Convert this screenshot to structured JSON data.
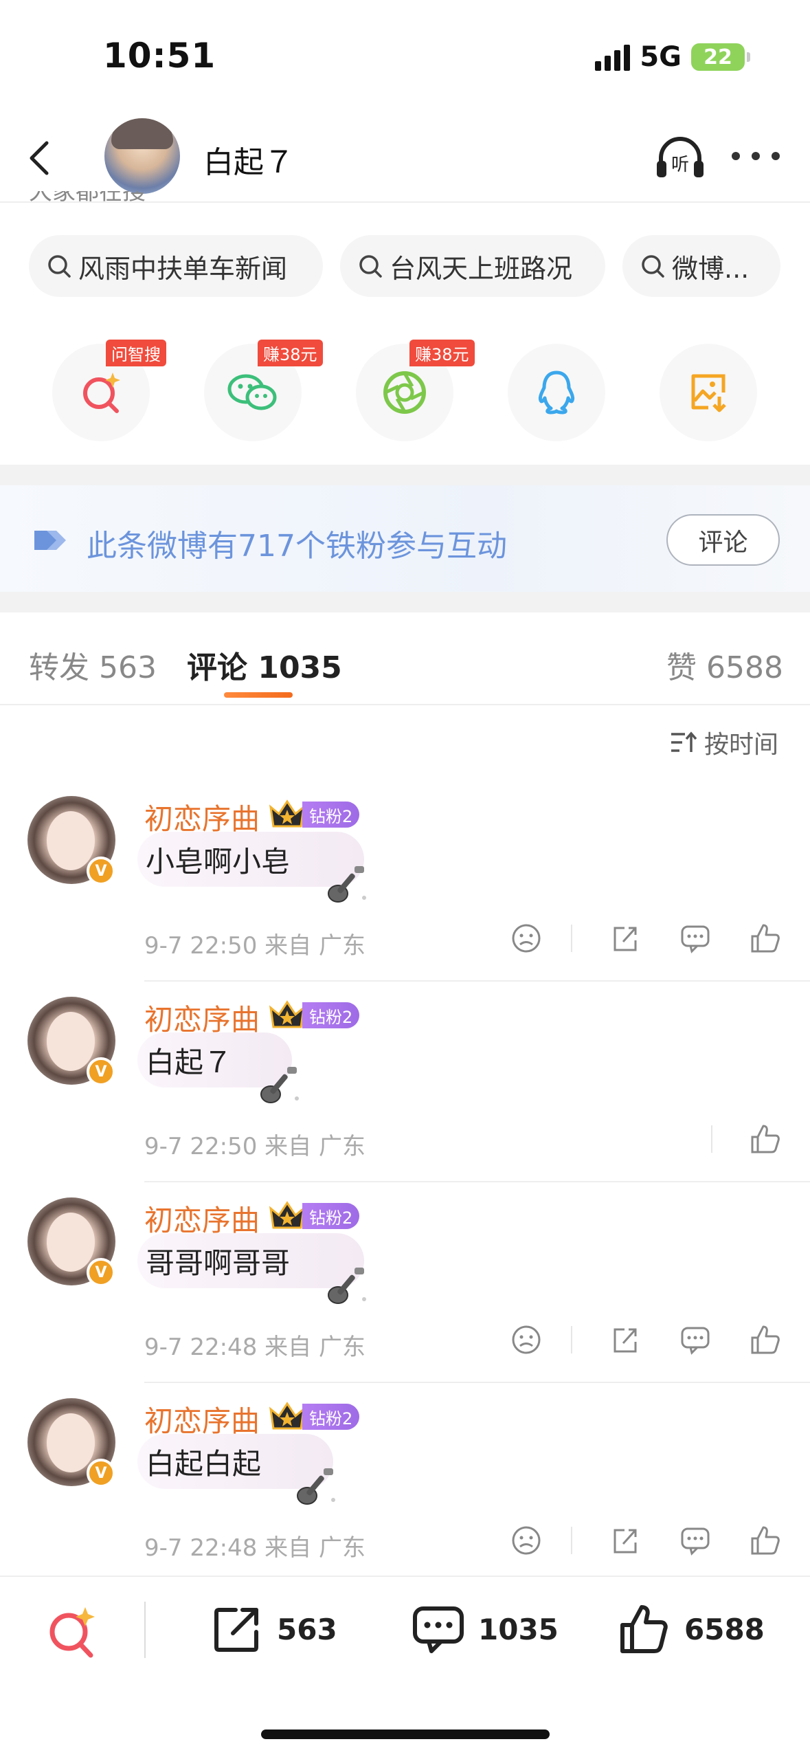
{
  "status_bar": {
    "time": "10:51",
    "network": "5G",
    "battery": "22"
  },
  "header": {
    "title": "白起７"
  },
  "hint_text": "大家都在搜",
  "search_chips": [
    {
      "label": "风雨中扶单车新闻"
    },
    {
      "label": "台风天上班路况"
    },
    {
      "label": "微博..."
    }
  ],
  "share_icons": [
    {
      "name": "ask-search",
      "badge": "问智搜"
    },
    {
      "name": "wechat",
      "badge": "赚38元"
    },
    {
      "name": "moments",
      "badge": "赚38元"
    },
    {
      "name": "qq",
      "badge": ""
    },
    {
      "name": "save-image",
      "badge": ""
    }
  ],
  "fan_banner": {
    "text": "此条微博有717个铁粉参与互动",
    "button": "评论"
  },
  "tabs": {
    "repost": {
      "label": "转发",
      "count": "563"
    },
    "comment": {
      "label": "评论",
      "count": "1035"
    },
    "like": {
      "label": "赞",
      "count": "6588"
    }
  },
  "sort_label": "按时间",
  "comments": [
    {
      "name": "初恋序曲",
      "fan_tag": "钻粉2",
      "text": "小皂啊小皂",
      "time": "9-7 22:50",
      "location": "来自 广东"
    },
    {
      "name": "初恋序曲",
      "fan_tag": "钻粉2",
      "text": "白起７",
      "time": "9-7 22:50",
      "location": "来自 广东"
    },
    {
      "name": "初恋序曲",
      "fan_tag": "钻粉2",
      "text": "哥哥啊哥哥",
      "time": "9-7 22:48",
      "location": "来自 广东"
    },
    {
      "name": "初恋序曲",
      "fan_tag": "钻粉2",
      "text": "白起白起",
      "time": "9-7 22:48",
      "location": "来自 广东"
    }
  ],
  "bottom_bar": {
    "repost_count": "563",
    "comment_count": "1035",
    "like_count": "6588"
  },
  "colors": {
    "accent_orange": "#e8742e",
    "fan_blue": "#6c94dc",
    "fan_tag_purple": "#a974ec",
    "badge_red": "#f04b3c"
  }
}
